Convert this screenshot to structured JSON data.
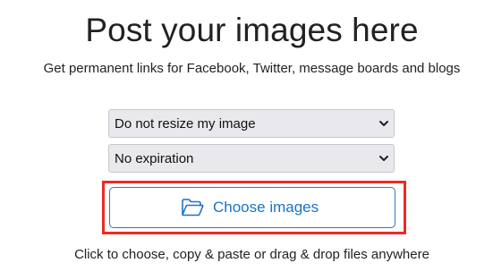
{
  "header": {
    "title": "Post your images here",
    "subtitle": "Get permanent links for Facebook, Twitter, message boards and blogs"
  },
  "form": {
    "resize_select": {
      "selected": "Do not resize my image",
      "icon": "chevron-down-icon"
    },
    "expiration_select": {
      "selected": "No expiration",
      "icon": "chevron-down-icon"
    },
    "choose_button": {
      "label": "Choose images",
      "icon": "folder-open-icon",
      "accent_color": "#1a73c8"
    },
    "highlight_color": "#ee2a24"
  },
  "footer": {
    "hint": "Click to choose, copy & paste or drag & drop files anywhere"
  }
}
